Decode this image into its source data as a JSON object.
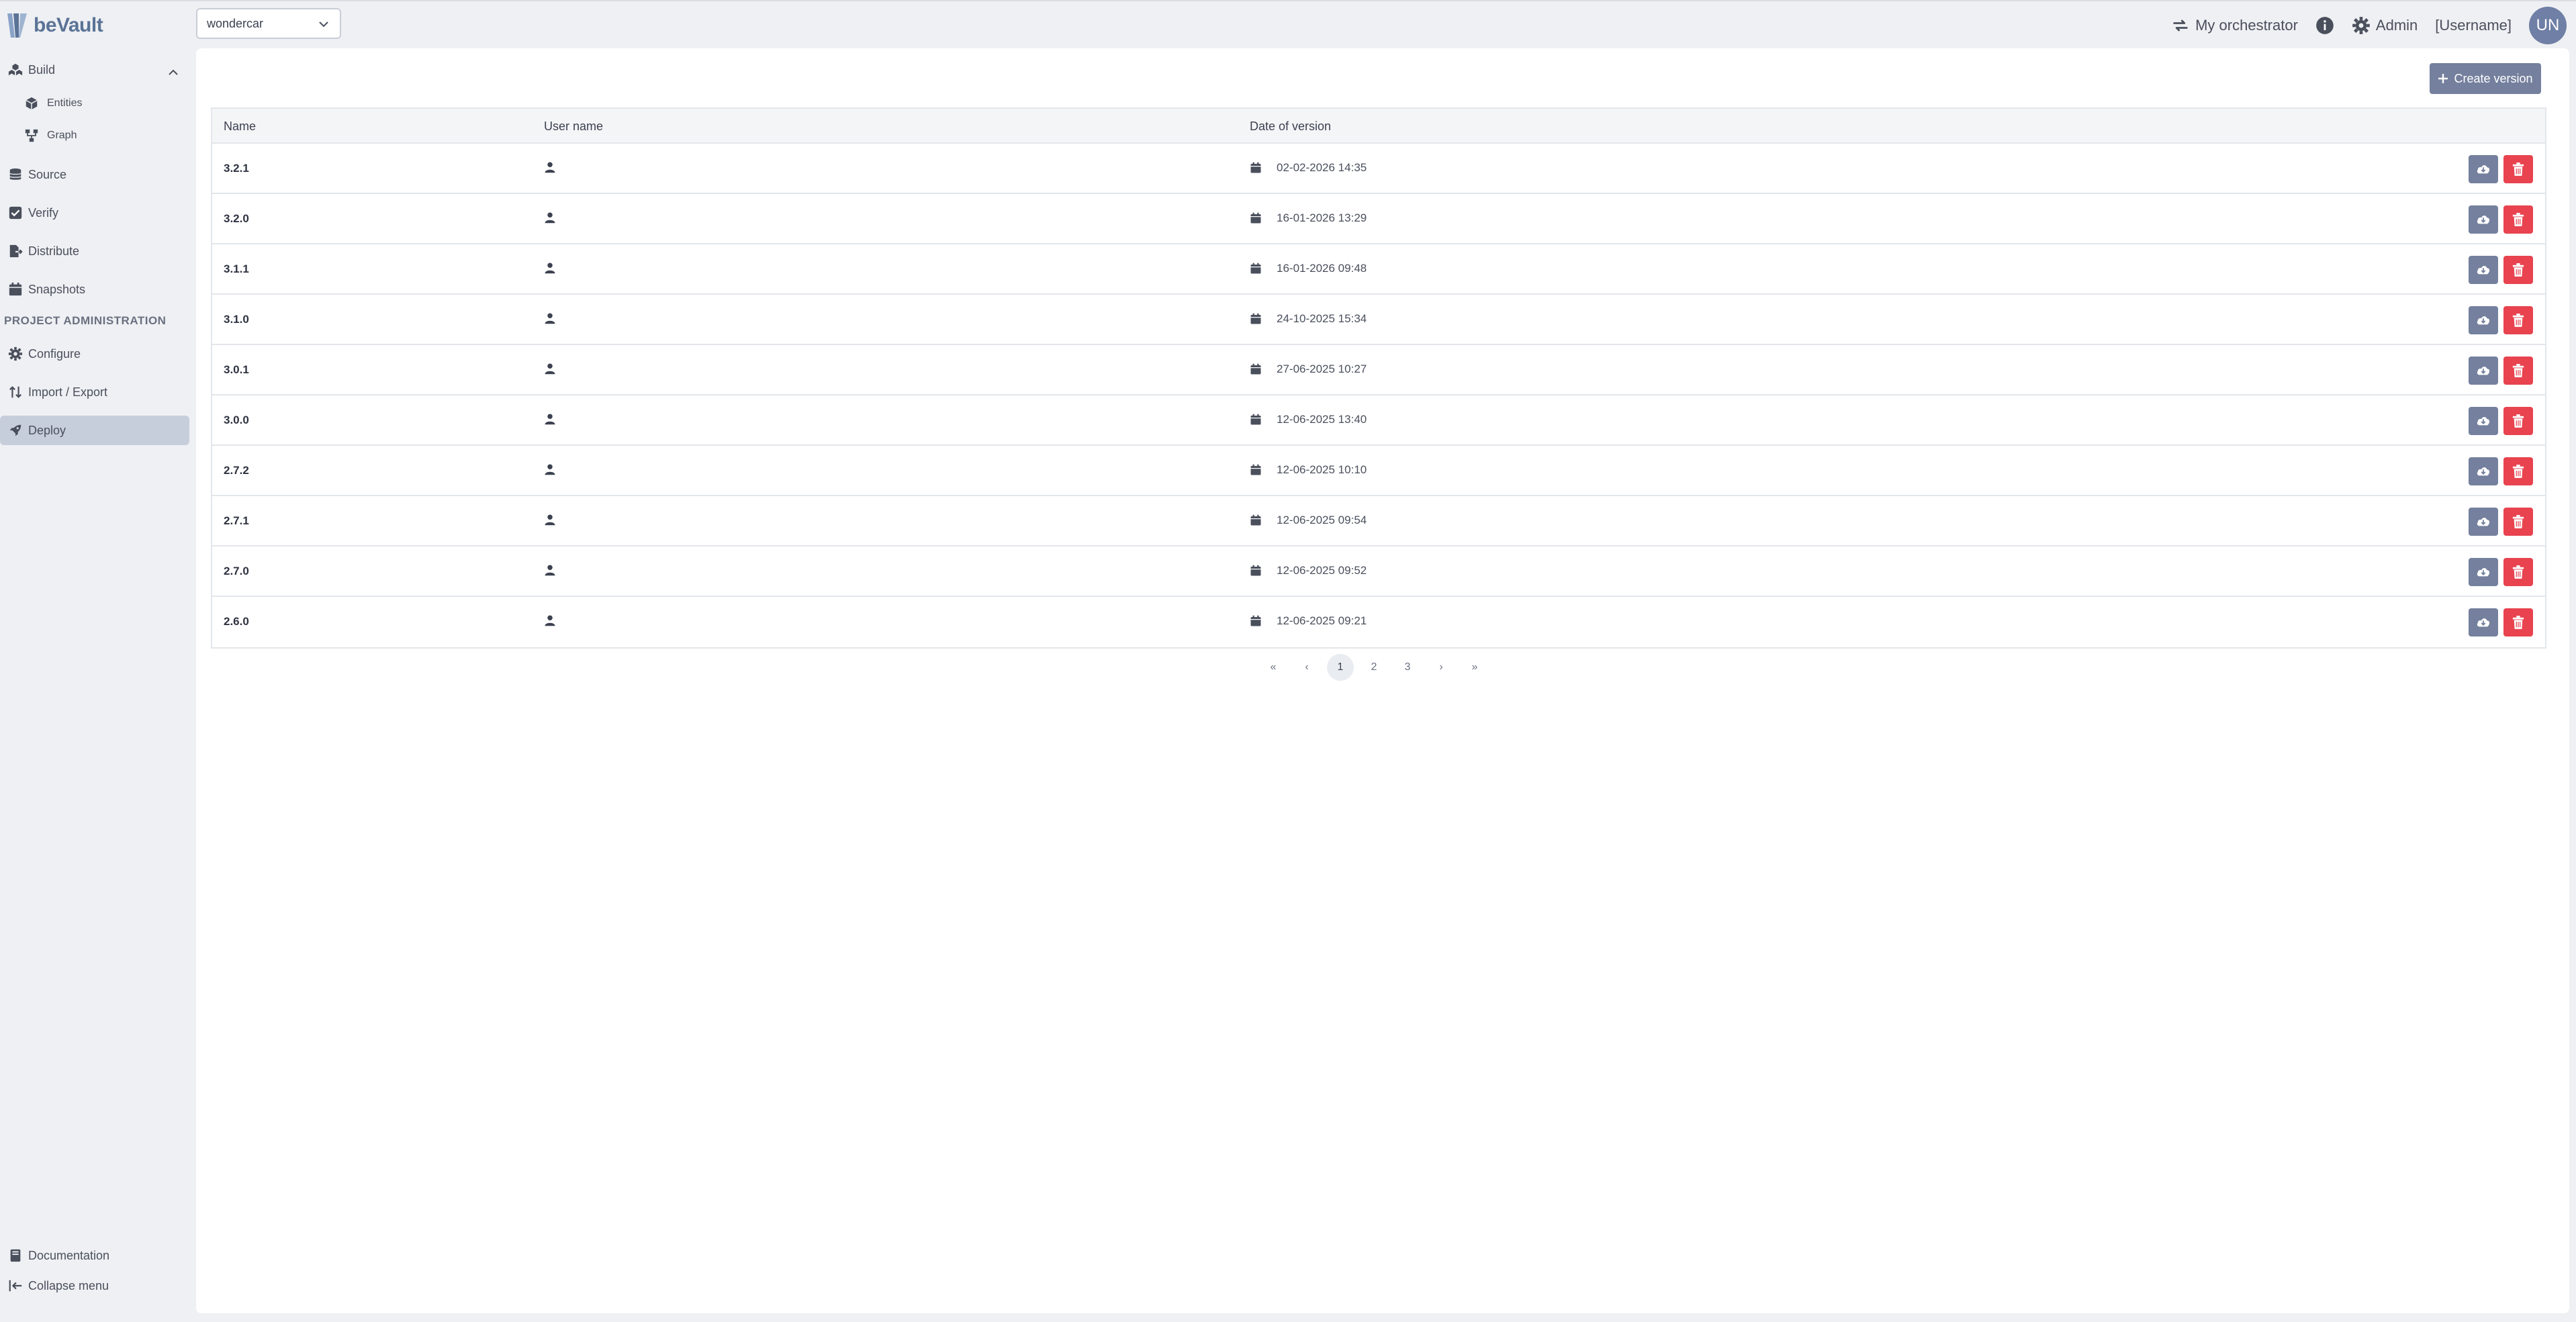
{
  "app": {
    "logo_text": "beVault"
  },
  "project_select": {
    "value": "wondercar"
  },
  "top_right": {
    "orchestrator_label": "My orchestrator",
    "admin_label": "Admin",
    "username": "[Username]",
    "avatar_initials": "UN"
  },
  "sidebar": {
    "build": "Build",
    "entities": "Entities",
    "graph": "Graph",
    "source": "Source",
    "verify": "Verify",
    "distribute": "Distribute",
    "snapshots": "Snapshots",
    "section_admin": "PROJECT ADMINISTRATION",
    "configure": "Configure",
    "import_export": "Import / Export",
    "deploy": "Deploy",
    "documentation": "Documentation",
    "collapse_menu": "Collapse menu"
  },
  "main": {
    "create_button": "Create version",
    "columns": {
      "name": "Name",
      "user": "User name",
      "date": "Date of version"
    },
    "rows": [
      {
        "name": "3.2.1",
        "user": "",
        "date": "02-02-2026 14:35"
      },
      {
        "name": "3.2.0",
        "user": "",
        "date": "16-01-2026 13:29"
      },
      {
        "name": "3.1.1",
        "user": "",
        "date": "16-01-2026 09:48"
      },
      {
        "name": "3.1.0",
        "user": "",
        "date": "24-10-2025 15:34"
      },
      {
        "name": "3.0.1",
        "user": "",
        "date": "27-06-2025 10:27"
      },
      {
        "name": "3.0.0",
        "user": "",
        "date": "12-06-2025 13:40"
      },
      {
        "name": "2.7.2",
        "user": "",
        "date": "12-06-2025 10:10"
      },
      {
        "name": "2.7.1",
        "user": "",
        "date": "12-06-2025 09:54"
      },
      {
        "name": "2.7.0",
        "user": "",
        "date": "12-06-2025 09:52"
      },
      {
        "name": "2.6.0",
        "user": "",
        "date": "12-06-2025 09:21"
      }
    ]
  },
  "pagination": {
    "first": "«",
    "prev": "‹",
    "pages": [
      "1",
      "2",
      "3"
    ],
    "current": "1",
    "next": "›",
    "last": "»"
  },
  "colors": {
    "accent": "#74809d",
    "danger": "#e8434f",
    "active_nav": "#c7cedb"
  }
}
